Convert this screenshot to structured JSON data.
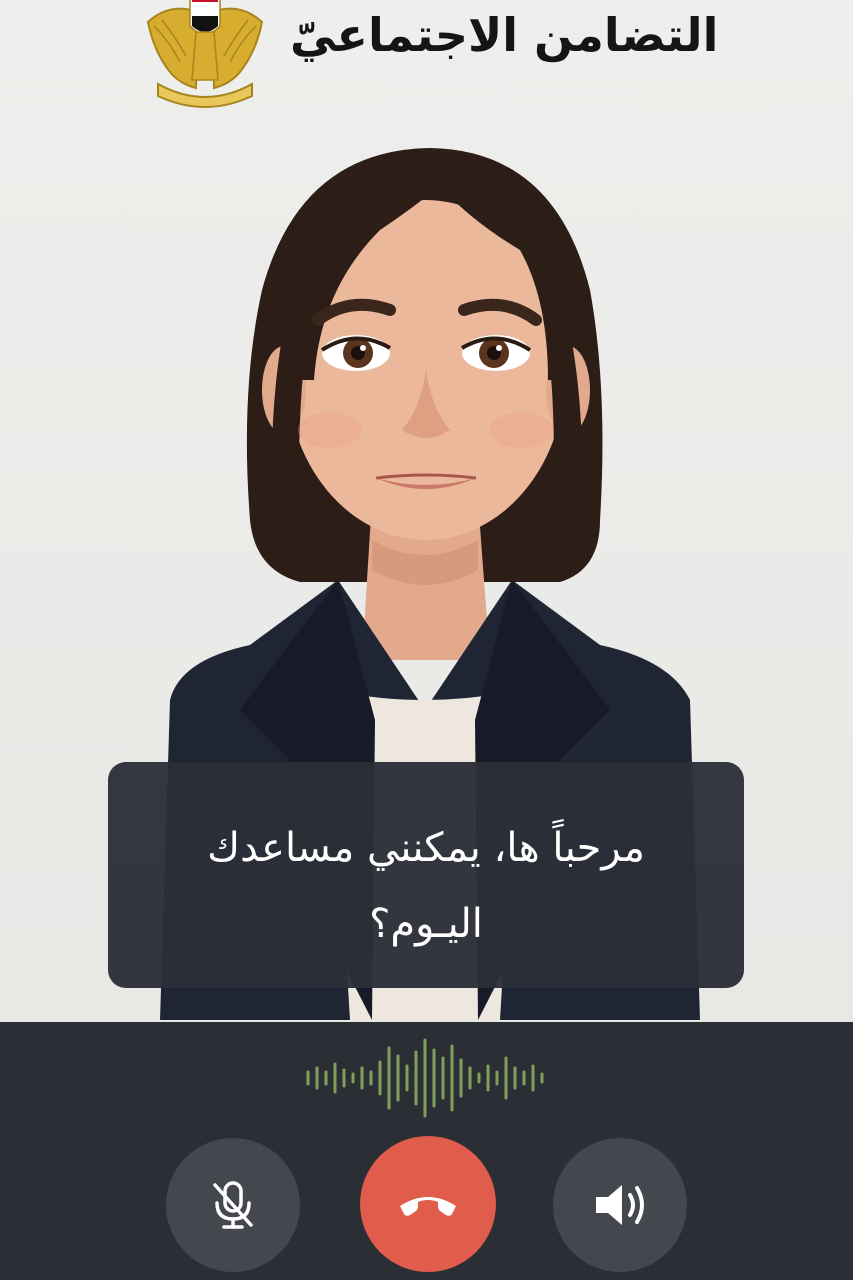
{
  "header": {
    "title": "التضامن الاجتماعيّ"
  },
  "caption": {
    "line1": "مرحباً ها، يمكنني مساعدك",
    "line2": "اليـوم؟"
  },
  "controls": {
    "mute_icon": "mic-off-icon",
    "hangup_icon": "phone-hangup-icon",
    "speaker_icon": "speaker-volume-icon"
  },
  "colors": {
    "header_text": "#151515",
    "call_bar": "#2b2e35",
    "caption_bg": "#2c2f38",
    "hangup": "#e05c4b",
    "control_bg": "#44474d",
    "waveform": "#7fa05a",
    "emblem_gold": "#c9a227"
  }
}
